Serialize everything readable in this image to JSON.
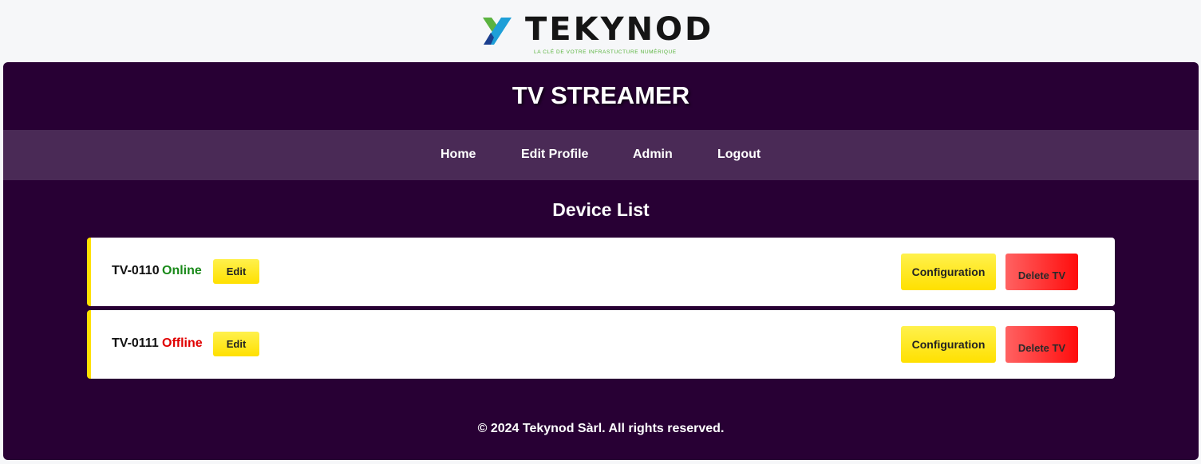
{
  "brand": {
    "name": "TEKYNOD",
    "tagline": "LA CLÉ DE VOTRE INFRASTUCTURE NUMÉRIQUE",
    "colors": {
      "blue": "#1e9fd8",
      "dark_blue": "#1b3f8f",
      "green": "#5bb340",
      "text": "#151515"
    }
  },
  "app": {
    "title": "TV STREAMER",
    "background": "#280034",
    "nav_background": "#4a2a56"
  },
  "nav": {
    "items": [
      {
        "label": "Home"
      },
      {
        "label": "Edit Profile"
      },
      {
        "label": "Admin"
      },
      {
        "label": "Logout"
      }
    ]
  },
  "device_list": {
    "title": "Device List",
    "devices": [
      {
        "name": "TV-0110",
        "status": "Online",
        "status_color": "#1a8a1a",
        "edit_label": "Edit",
        "config_label": "Configuration",
        "delete_label": "Delete TV"
      },
      {
        "name": "TV-0111",
        "status": "Offline",
        "status_color": "#e00000",
        "edit_label": "Edit",
        "config_label": "Configuration",
        "delete_label": "Delete TV"
      }
    ]
  },
  "footer": {
    "text": "© 2024 Tekynod Sàrl. All rights reserved."
  }
}
